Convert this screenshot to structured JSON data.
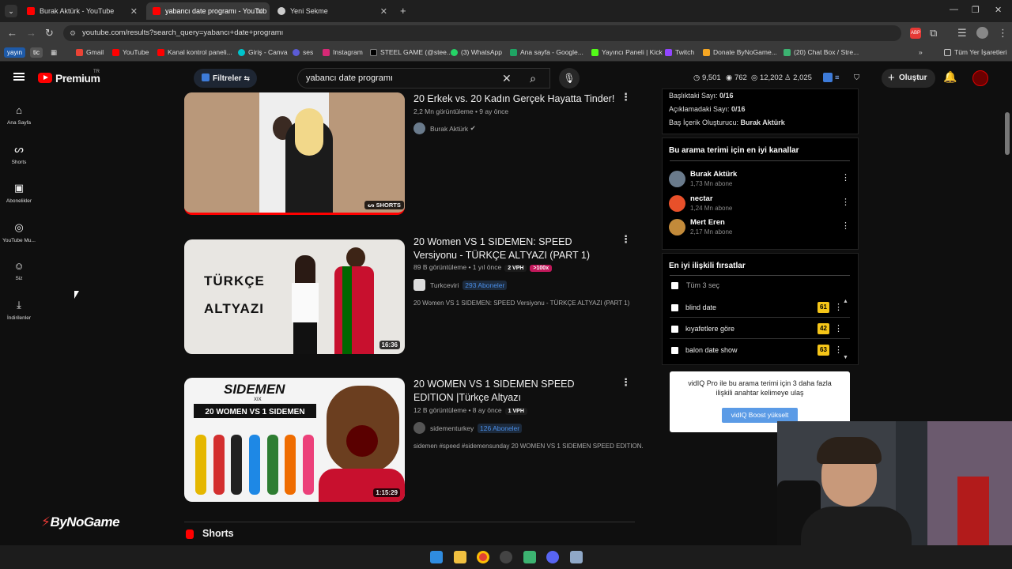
{
  "browser": {
    "tabs": [
      {
        "label": "Burak Aktürk - YouTube",
        "active": false
      },
      {
        "label": "yabancı date programı - YouTub",
        "active": true
      },
      {
        "label": "Yeni Sekme",
        "active": false
      }
    ],
    "url": "youtube.com/results?search_query=yabancı+date+programı",
    "bookmark_chips": [
      "yayın",
      "tic"
    ],
    "bookmarks": [
      "Gmail",
      "YouTube",
      "Kanal kontrol paneli...",
      "Giriş - Canva",
      "ses",
      "Instagram",
      "STEEL GAME (@stee...",
      "(3) WhatsApp",
      "Ana sayfa - Google...",
      "Yayıncı Paneli | Kick",
      "Twitch",
      "Donate ByNoGame...",
      "(20) Chat Box / Stre..."
    ],
    "all_bookmarks_label": "Tüm Yer İşaretleri"
  },
  "header": {
    "logo_text": "Premium",
    "logo_sup": "TR",
    "filters_label": "Filtreler",
    "search_value": "yabancı date programı",
    "stats": [
      "9,501",
      "762",
      "12,202",
      "2,025"
    ],
    "create_label": "Oluştur"
  },
  "sidebar": [
    {
      "icon": "home-icon",
      "label": "Ana Sayfa"
    },
    {
      "icon": "shorts-icon",
      "label": "Shorts"
    },
    {
      "icon": "subscriptions-icon",
      "label": "Abonelikler"
    },
    {
      "icon": "youtube-music-icon",
      "label": "YouTube Mu..."
    },
    {
      "icon": "you-icon",
      "label": "Siz"
    },
    {
      "icon": "download-icon",
      "label": "İndirilenler"
    }
  ],
  "videos": [
    {
      "title": "20 Erkek vs. 20 Kadın Gerçek Hayatta Tinder!",
      "meta": "2,2 Mn görüntüleme • 9 ay önce",
      "channel": "Burak Aktürk",
      "thumb_badge": "SHORTS"
    },
    {
      "title": "20 Women VS 1 SIDEMEN: SPEED Versiyonu - TÜRKÇE ALTYAZI (PART 1)",
      "meta": "89 B görüntüleme • 1 yıl önce",
      "vph": "2 VPH",
      "outlier": ">100x",
      "channel": "Turkceviri",
      "subs": "293 Aboneler",
      "desc": "20 Women VS 1 SIDEMEN: SPEED Versiyonu - TÜRKÇE ALTYAZI (PART 1)",
      "thumb_text_1": "TÜRKÇE",
      "thumb_text_2": "ALTYAZI",
      "duration": "16:36"
    },
    {
      "title": "20 WOMEN VS 1 SIDEMEN SPEED EDITION |Türkçe Altyazı",
      "meta": "12 B görüntüleme • 8 ay önce",
      "vph": "1 VPH",
      "channel": "sidementurkey",
      "subs": "126 Aboneler",
      "desc": "sidemen #speed #sidemensunday 20 WOMEN VS 1 SIDEMEN SPEED EDITION.",
      "thumb_logo": "SIDEMEN",
      "thumb_sub": "XIX",
      "thumb_banner": "20 WOMEN VS 1 SIDEMEN",
      "duration": "1:15:29"
    }
  ],
  "shorts_label": "Shorts",
  "watermark": "ByNoGame",
  "vidiq": {
    "title_count_label": "Başlıktaki Sayı:",
    "title_count": "0/16",
    "desc_count_label": "Açıklamadaki Sayı:",
    "desc_count": "0/16",
    "creator_label": "Baş İçerik Oluşturucu:",
    "creator": "Burak Aktürk",
    "channels_heading": "Bu arama terimi için en iyi kanallar",
    "channels": [
      {
        "name": "Burak Aktürk",
        "subs": "1,73 Mn abone"
      },
      {
        "name": "nectar",
        "subs": "1,24 Mn abone"
      },
      {
        "name": "Mert Eren",
        "subs": "2,17 Mn abone"
      }
    ],
    "opp_heading": "En iyi ilişkili fırsatlar",
    "select_all": "Tüm 3 seç",
    "keywords": [
      {
        "label": "blind date",
        "score": "61"
      },
      {
        "label": "kıyafetlere göre",
        "score": "42"
      },
      {
        "label": "balon date show",
        "score": "63"
      }
    ],
    "promo": "vidIQ Pro ile bu arama terimi için 3 daha fazla ilişkili anahtar kelimeye ulaş",
    "boost_label": "vidIQ Boost yükselt"
  }
}
